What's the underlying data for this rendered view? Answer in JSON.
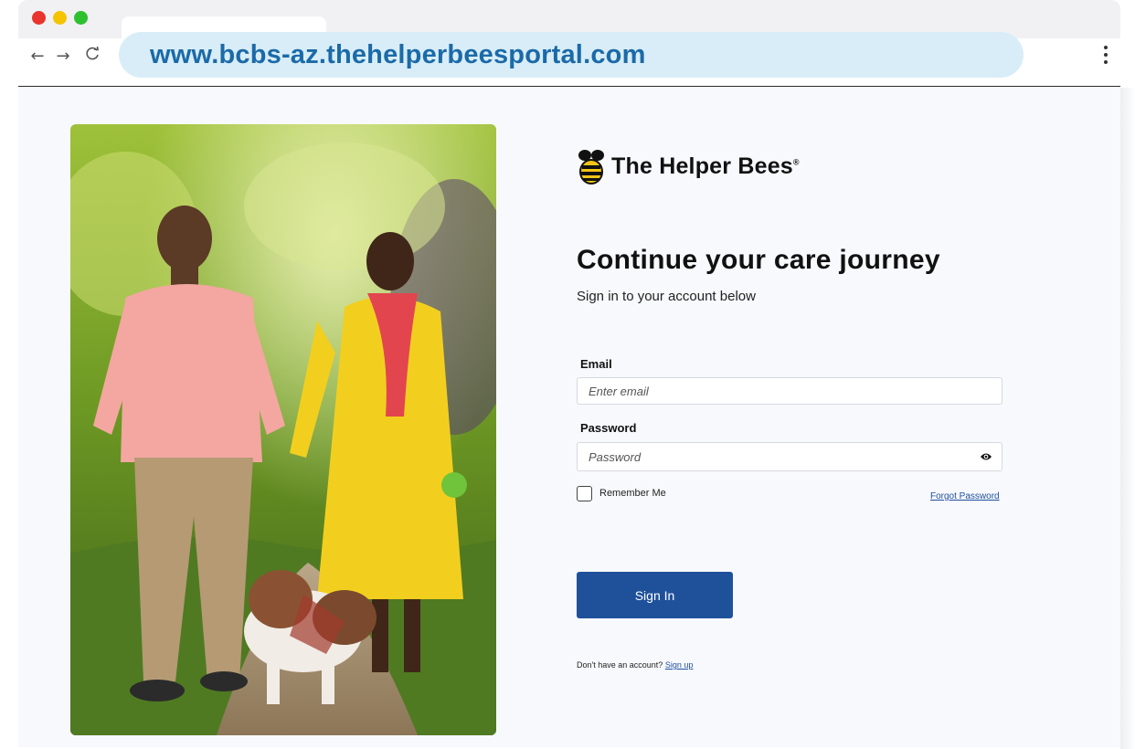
{
  "browser": {
    "url": "www.bcbs-az.thehelperbeesportal.com",
    "traffic_lights": [
      "#e8342c",
      "#f5c400",
      "#2fc02f"
    ],
    "back_icon": "←",
    "forward_icon": "→",
    "reload_icon": "C"
  },
  "brand": {
    "name": "The Helper Bees",
    "registered": "®"
  },
  "login": {
    "heading": "Continue your care journey",
    "subheading": "Sign in to your account below",
    "email_label": "Email",
    "email_placeholder": "Enter email",
    "password_label": "Password",
    "password_placeholder": "Password",
    "remember_label": "Remember Me",
    "forgot_label": "Forgot Password",
    "signin_label": "Sign In",
    "no_account_text": "Don't have an account?",
    "signup_label": "Sign up"
  },
  "colors": {
    "primary_button": "#1f519b",
    "link": "#1d4e9e",
    "url_text": "#1b6aa8",
    "url_bar": "#d8edf7"
  }
}
